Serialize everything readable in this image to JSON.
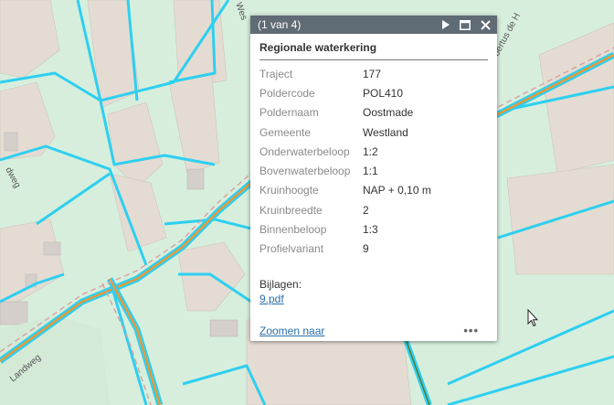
{
  "map": {
    "street_labels": [
      "Landweg",
      "Wes",
      "bertus de H",
      "dweg"
    ]
  },
  "popup": {
    "pager": "(1 van 4)",
    "title": "Regionale waterkering",
    "attributes": [
      {
        "key": "Traject",
        "value": "177"
      },
      {
        "key": "Poldercode",
        "value": "POL410"
      },
      {
        "key": "Poldernaam",
        "value": "Oostmade"
      },
      {
        "key": "Gemeente",
        "value": "Westland"
      },
      {
        "key": "Onderwaterbeloop",
        "value": "1:2"
      },
      {
        "key": "Bovenwaterbeloop",
        "value": "1:1"
      },
      {
        "key": "Kruinhoogte",
        "value": "NAP + 0,10 m"
      },
      {
        "key": "Kruinbreedte",
        "value": "2"
      },
      {
        "key": "Binnenbeloop",
        "value": "1:3"
      },
      {
        "key": "Profielvariant",
        "value": "9"
      }
    ],
    "attachments_label": "Bijlagen:",
    "attachment": "9.pdf",
    "zoom_label": "Zoomen naar",
    "more_label": "•••"
  }
}
